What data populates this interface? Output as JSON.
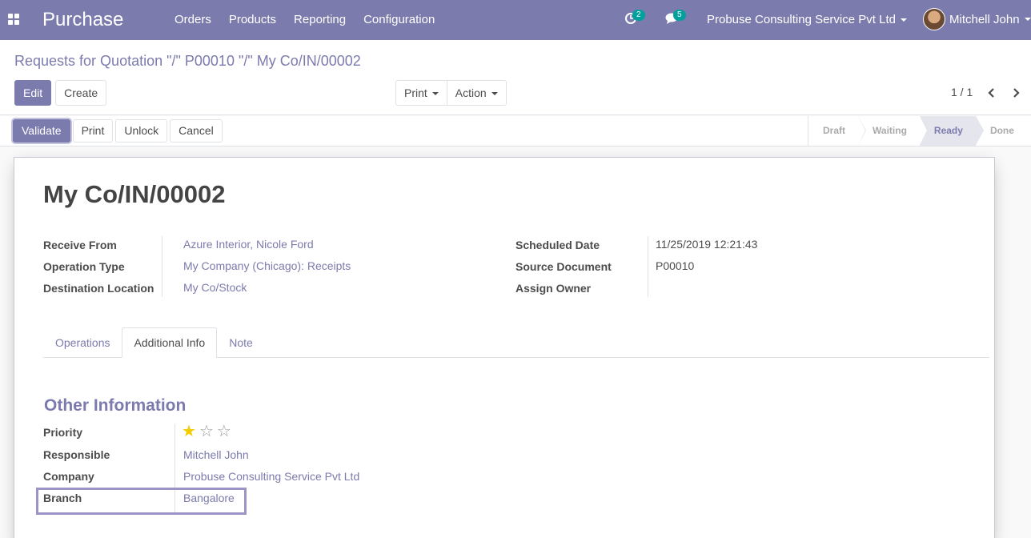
{
  "navbar": {
    "app_name": "Purchase",
    "menu": [
      "Orders",
      "Products",
      "Reporting",
      "Configuration"
    ],
    "activity_count": "2",
    "message_count": "5",
    "company": "Probuse Consulting Service Pvt Ltd",
    "user": "Mitchell John"
  },
  "breadcrumb": "Requests for Quotation \"/\" P00010 \"/\" My Co/IN/00002",
  "buttons": {
    "edit": "Edit",
    "create": "Create",
    "print": "Print",
    "action": "Action"
  },
  "pager": "1 / 1",
  "status_actions": [
    "Validate",
    "Print",
    "Unlock",
    "Cancel"
  ],
  "stages": [
    {
      "label": "Draft",
      "active": false
    },
    {
      "label": "Waiting",
      "active": false
    },
    {
      "label": "Ready",
      "active": true
    },
    {
      "label": "Done",
      "active": false
    }
  ],
  "record": {
    "title": "My Co/IN/00002",
    "left_fields": [
      {
        "label": "Receive From",
        "value": "Azure Interior, Nicole Ford"
      },
      {
        "label": "Operation Type",
        "value": "My Company (Chicago): Receipts"
      },
      {
        "label": "Destination Location",
        "value": "My Co/Stock"
      }
    ],
    "right_fields": [
      {
        "label": "Scheduled Date",
        "value": "11/25/2019 12:21:43"
      },
      {
        "label": "Source Document",
        "value": "P00010"
      },
      {
        "label": "Assign Owner",
        "value": ""
      }
    ]
  },
  "tabs": [
    {
      "label": "Operations",
      "active": false
    },
    {
      "label": "Additional Info",
      "active": true
    },
    {
      "label": "Note",
      "active": false
    }
  ],
  "other_info": {
    "title": "Other Information",
    "priority_label": "Priority",
    "priority_stars": 1,
    "priority_max": 3,
    "responsible_label": "Responsible",
    "responsible": "Mitchell John",
    "company_label": "Company",
    "company": "Probuse Consulting Service Pvt Ltd",
    "branch_label": "Branch",
    "branch": "Bangalore"
  },
  "colors": {
    "brand": "#7c7bad",
    "star_on": "#f3cc00",
    "badge": "#00a09d"
  }
}
